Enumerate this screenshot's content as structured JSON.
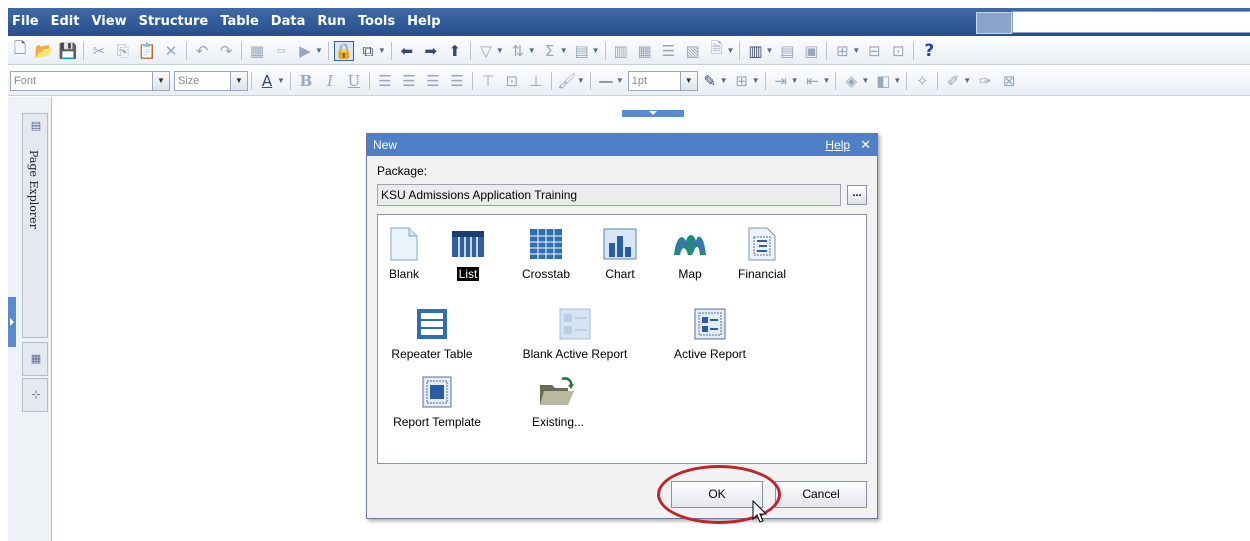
{
  "menu": [
    "File",
    "Edit",
    "View",
    "Structure",
    "Table",
    "Data",
    "Run",
    "Tools",
    "Help"
  ],
  "format_bar": {
    "font_placeholder": "Font",
    "size_placeholder": "Size",
    "line_width": "1pt"
  },
  "side_panel": {
    "page_explorer_label": "Page Explorer"
  },
  "dialog": {
    "title": "New",
    "help_link": "Help",
    "close_glyph": "✕",
    "package_label": "Package:",
    "package_value": "KSU Admissions Application Training",
    "browse_label": "...",
    "items": [
      {
        "label": "Blank",
        "icon": "blank-doc-icon"
      },
      {
        "label": "List",
        "icon": "list-icon",
        "selected": true
      },
      {
        "label": "Crosstab",
        "icon": "crosstab-icon"
      },
      {
        "label": "Chart",
        "icon": "chart-icon"
      },
      {
        "label": "Map",
        "icon": "map-icon"
      },
      {
        "label": "Financial",
        "icon": "financial-icon"
      },
      {
        "label": "Repeater Table",
        "icon": "repeater-table-icon"
      },
      {
        "label": "Blank Active Report",
        "icon": "blank-active-report-icon"
      },
      {
        "label": "Active Report",
        "icon": "active-report-icon"
      },
      {
        "label": "Report Template",
        "icon": "report-template-icon"
      },
      {
        "label": "Existing...",
        "icon": "open-folder-icon"
      }
    ],
    "ok_label": "OK",
    "cancel_label": "Cancel"
  },
  "colors": {
    "menu_bar": "#264f8c",
    "dialog_title": "#4f7fc6",
    "highlight": "#c0232b",
    "selection": "#000000"
  }
}
